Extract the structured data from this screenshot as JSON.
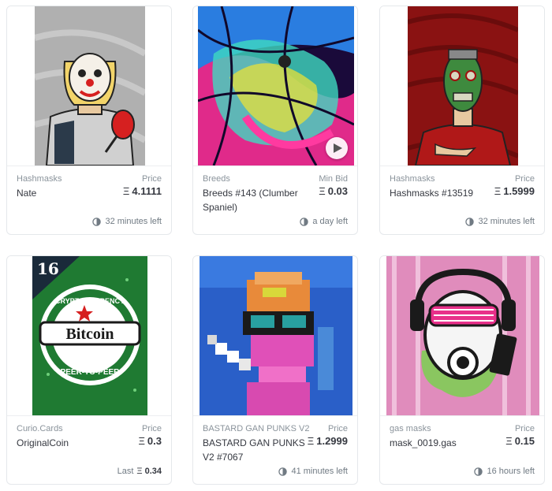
{
  "cards": [
    {
      "collection": "Hashmasks",
      "price_label": "Price",
      "title": "Nate",
      "currency": "Ξ",
      "price": "4.1111",
      "time": "32 minutes left"
    },
    {
      "collection": "Breeds",
      "price_label": "Min Bid",
      "title": "Breeds #143 (Clumber Spaniel)",
      "currency": "Ξ",
      "price": "0.03",
      "time": "a day left"
    },
    {
      "collection": "Hashmasks",
      "price_label": "Price",
      "title": "Hashmasks #13519",
      "currency": "Ξ",
      "price": "1.5999",
      "time": "32 minutes left"
    },
    {
      "collection": "Curio.Cards",
      "price_label": "Price",
      "title": "OriginalCoin",
      "currency": "Ξ",
      "price": "0.3",
      "last_label": "Last",
      "last_price": "0.34",
      "art_number": "16",
      "art_text_top": "CRYPTOCURRENCY",
      "art_text_main": "Bitcoin",
      "art_text_bottom": "PEER-TO-PEER"
    },
    {
      "collection": "BASTARD GAN PUNKS V2",
      "price_label": "Price",
      "title": "BASTARD GAN PUNKS V2 #7067",
      "currency": "Ξ",
      "price": "1.2999",
      "time": "41 minutes left"
    },
    {
      "collection": "gas masks",
      "price_label": "Price",
      "title": "mask_0019.gas",
      "currency": "Ξ",
      "price": "0.15",
      "time": "16 hours left"
    }
  ],
  "colors": {
    "accent": "#2081e2",
    "text": "#353840",
    "muted": "#8a939b",
    "border": "#e5e8eb"
  },
  "icons": {
    "clock": "clock-icon",
    "play": "play-icon"
  }
}
